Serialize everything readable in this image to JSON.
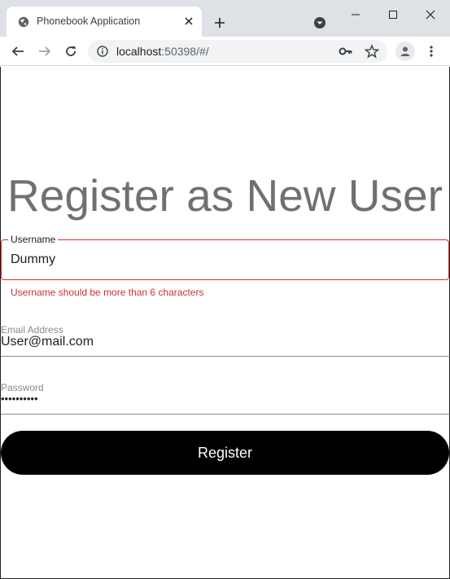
{
  "browser": {
    "tab_title": "Phonebook Application",
    "url_host": "localhost",
    "url_rest": ":50398/#/"
  },
  "icons": {
    "favicon": "globe-icon",
    "tab_close": "close-icon",
    "new_tab": "plus-icon",
    "tab_search": "dropdown-circle-icon",
    "minimize": "minimize-icon",
    "maximize": "maximize-icon",
    "close_window": "close-icon",
    "back": "back-arrow-icon",
    "forward": "forward-arrow-icon",
    "reload": "reload-icon",
    "site_info": "info-icon",
    "password_key": "key-icon",
    "bookmark": "star-icon",
    "profile": "person-icon",
    "menu": "kebab-menu-icon"
  },
  "page": {
    "heading": "Register as New User",
    "username": {
      "label": "Username",
      "value": "Dummy",
      "error": "Username should be more than 6 characters"
    },
    "email": {
      "label": "Email Address",
      "value": "User@mail.com"
    },
    "password": {
      "label": "Password",
      "value": "••••••••••"
    },
    "register_label": "Register"
  },
  "colors": {
    "error": "#d32f2f",
    "heading": "#707070",
    "button_bg": "#000000",
    "button_text": "#ffffff"
  }
}
